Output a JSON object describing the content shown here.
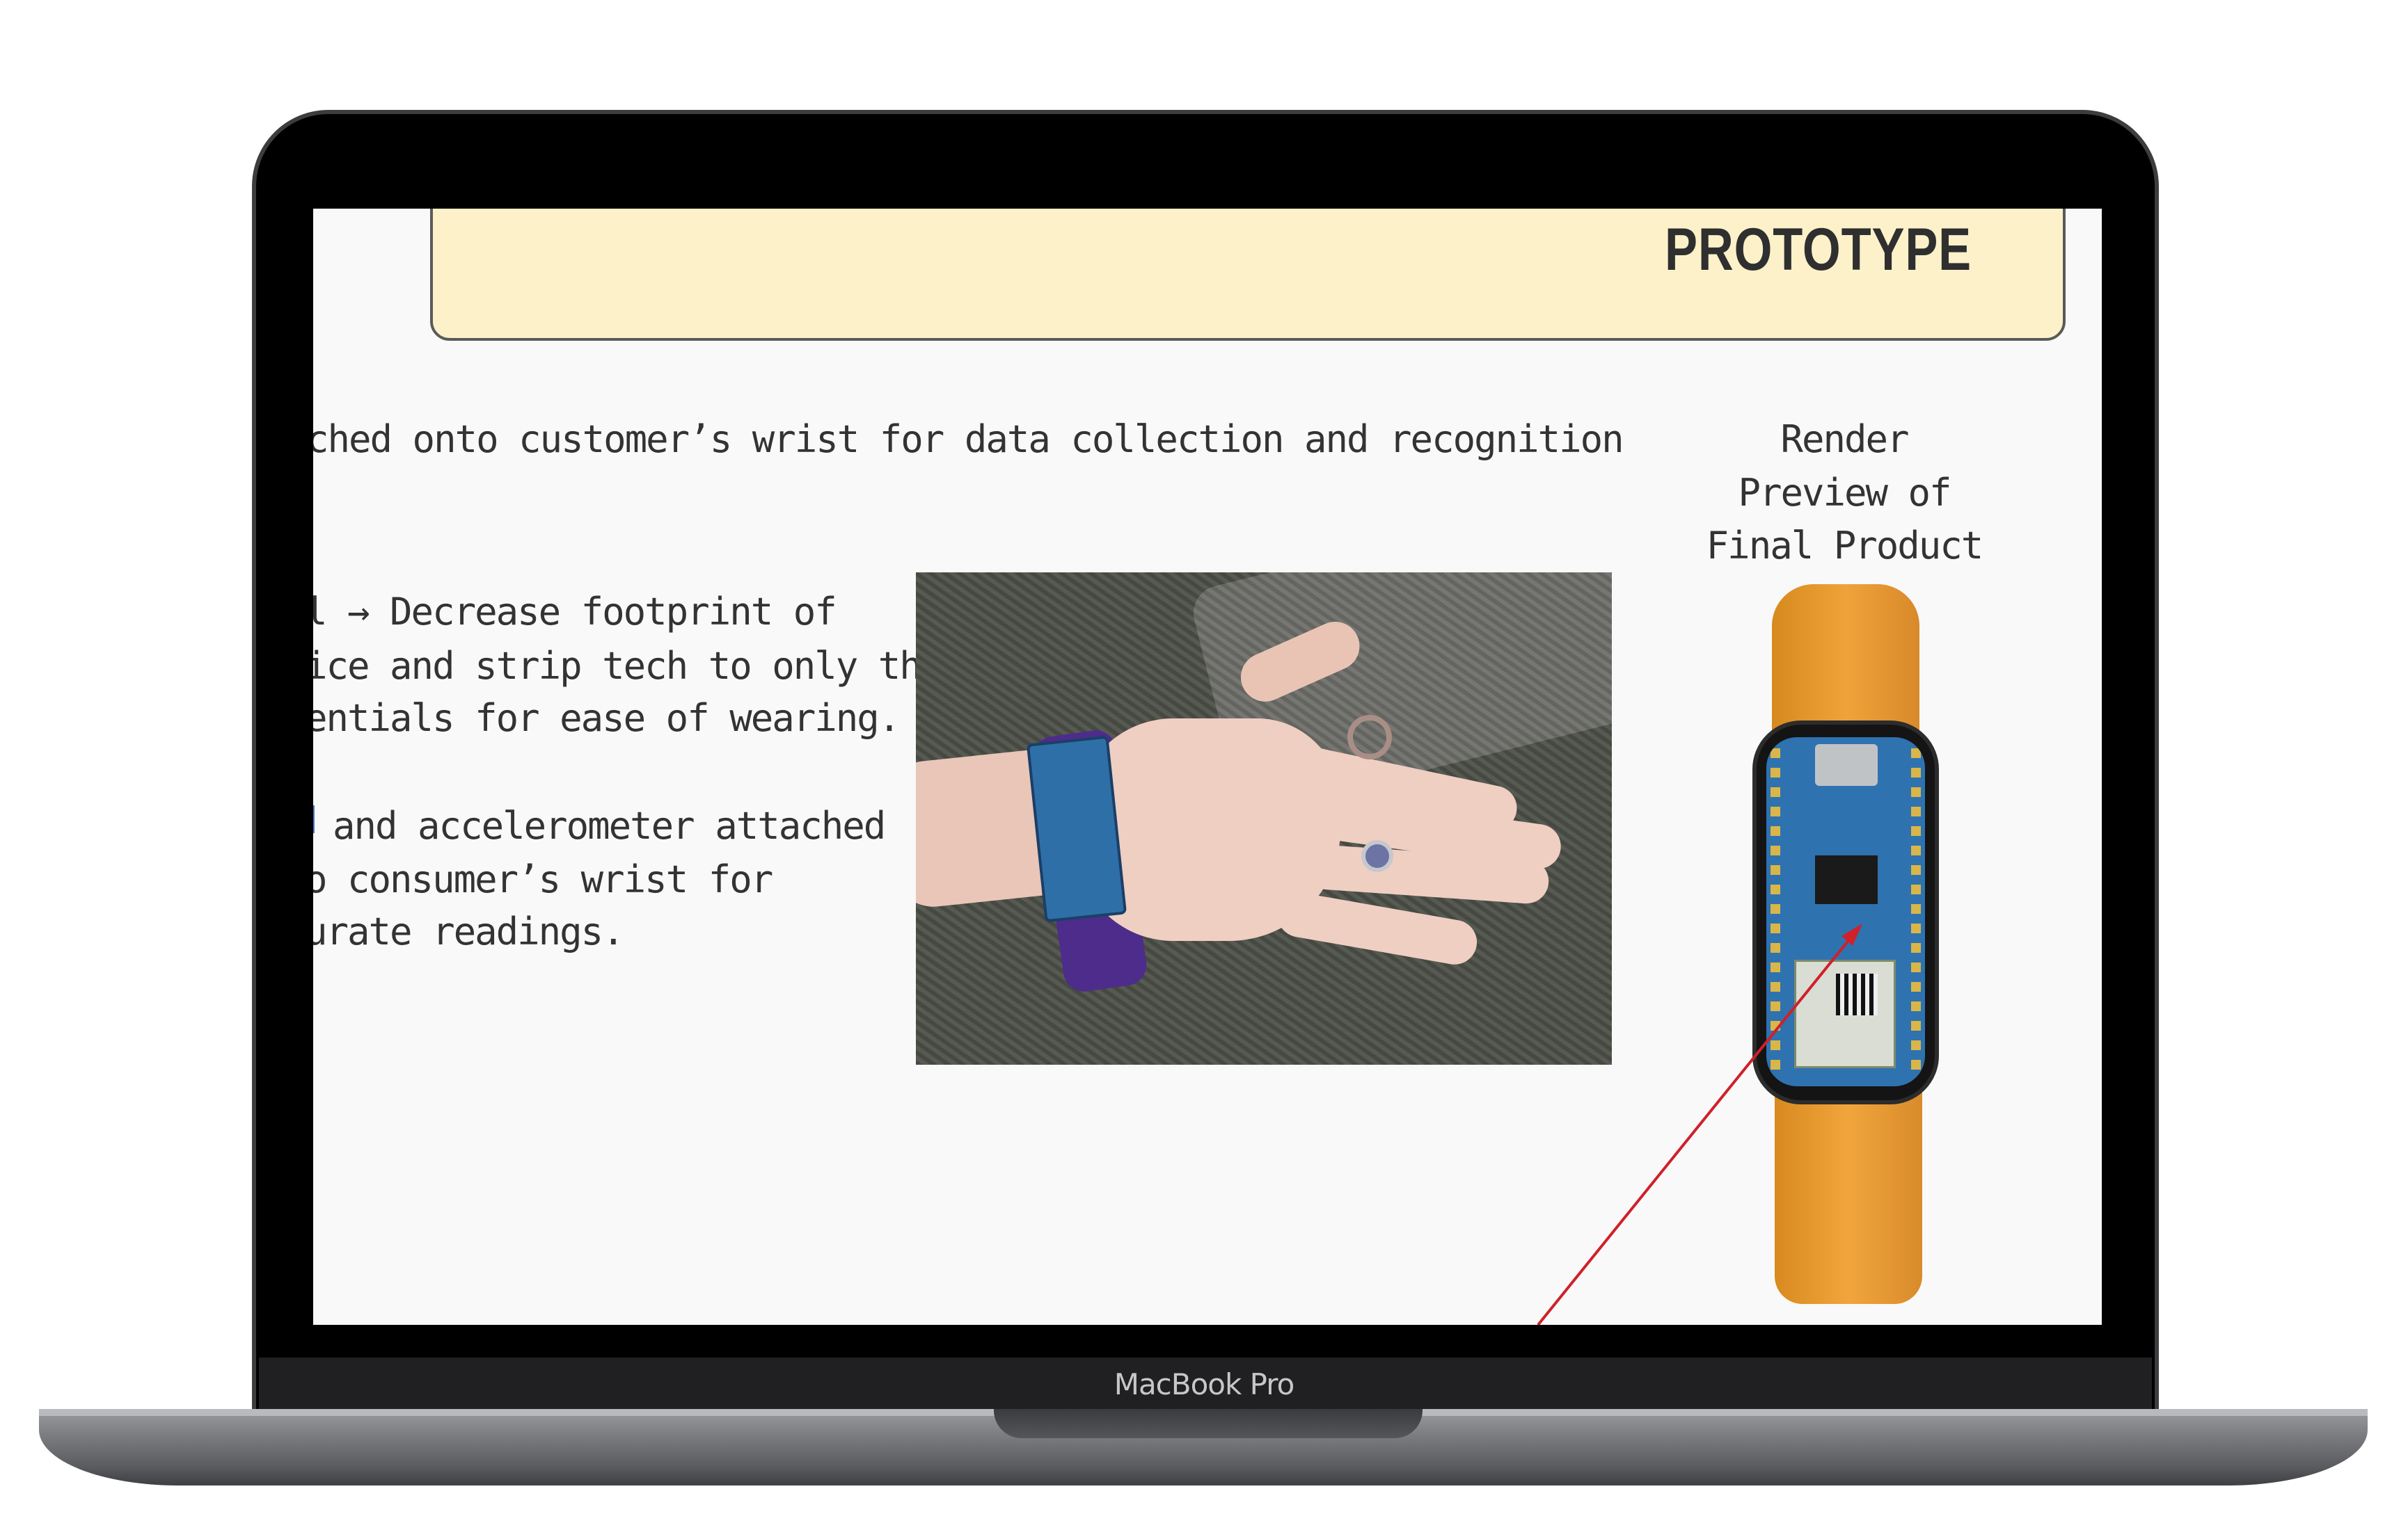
{
  "device": {
    "brand_label": "MacBook Pro"
  },
  "slide": {
    "title": "PROTOTYPE",
    "intro_line": "ched onto customer’s wrist for data collection and recognition",
    "points": [
      {
        "lines": [
          "l → Decrease footprint of",
          "ice and strip tech to only the",
          "entials for ease of wearing."
        ]
      },
      {
        "lines": [
          "and accelerometer attached",
          "o consumer’s wrist for",
          "urate readings."
        ]
      }
    ],
    "render_label_lines": [
      "Render",
      "Preview of",
      "Final Product"
    ]
  },
  "images": {
    "prototype_photo": "wrist-with-arduino-board-photo",
    "render_preview": "orange-band-wearable-render"
  },
  "colors": {
    "banner_bg": "#fdf1c9",
    "band_orange": "#f0a23a",
    "annotation_arrow": "#d0202a"
  }
}
